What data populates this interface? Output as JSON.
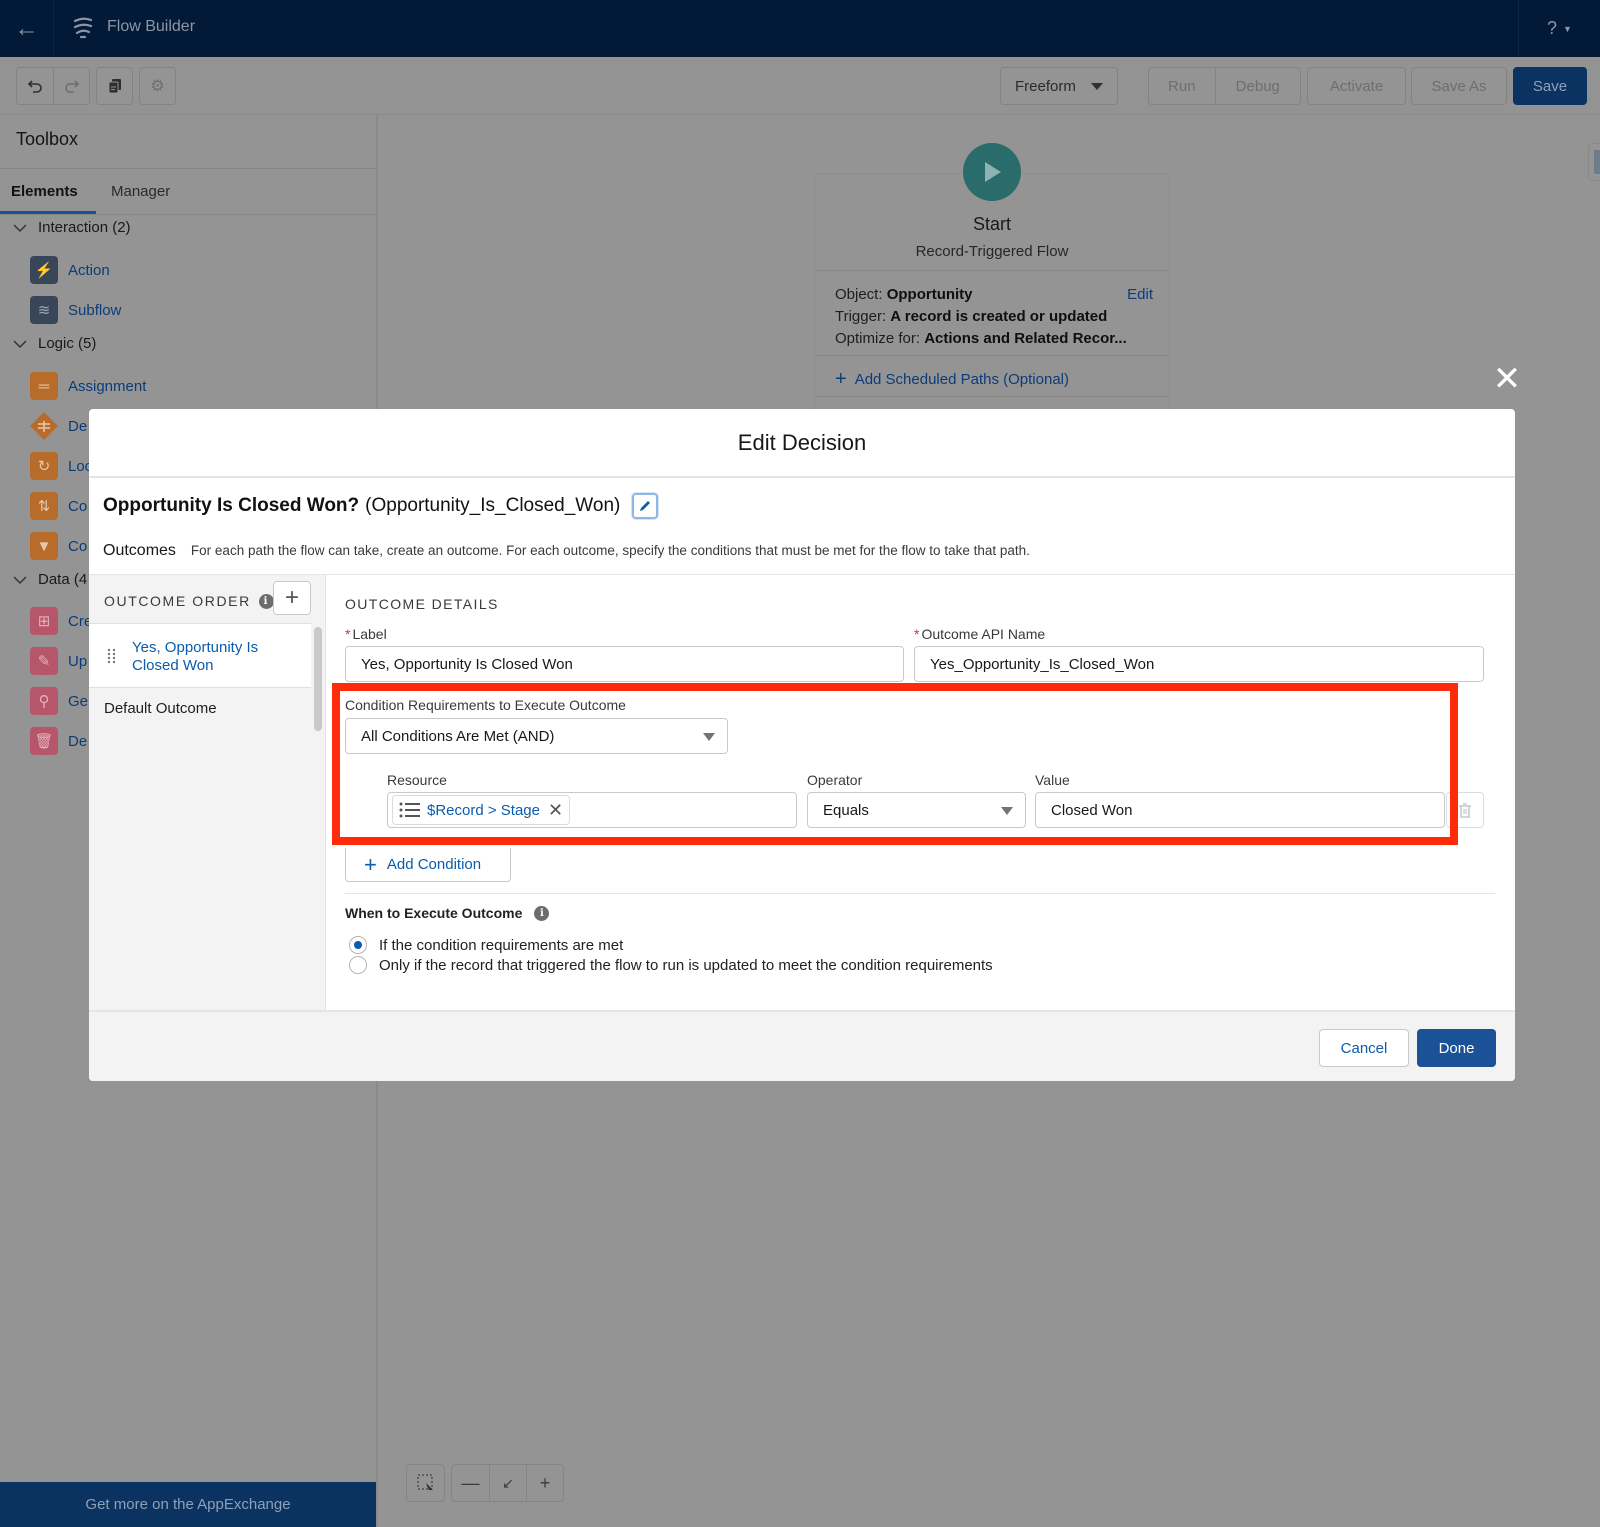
{
  "topbar": {
    "back_icon": "arrow-left-icon",
    "app_icon": "flow-icon",
    "app_title": "Flow Builder",
    "help_label": "?"
  },
  "toolbar": {
    "undo_icon": "undo-icon",
    "redo_icon": "redo-icon",
    "copy_icon": "copy-icon",
    "settings_icon": "gear-icon",
    "layout_select": "Freeform",
    "run_label": "Run",
    "debug_label": "Debug",
    "activate_label": "Activate",
    "save_as_label": "Save As",
    "save_label": "Save"
  },
  "toolbox": {
    "title": "Toolbox",
    "tabs": [
      {
        "label": "Elements",
        "active": true
      },
      {
        "label": "Manager",
        "active": false
      }
    ],
    "sections": [
      {
        "label": "Interaction (2)",
        "items": [
          {
            "label": "Action",
            "icon": "lightning-icon"
          },
          {
            "label": "Subflow",
            "icon": "flow-icon"
          }
        ]
      },
      {
        "label": "Logic (5)",
        "items": [
          {
            "label": "Assignment",
            "icon": "equals-icon"
          },
          {
            "label": "De",
            "icon": "decision-icon"
          },
          {
            "label": "Loo",
            "icon": "loop-icon"
          },
          {
            "label": "Co",
            "icon": "sort-icon"
          },
          {
            "label": "Co",
            "icon": "filter-icon"
          }
        ]
      },
      {
        "label": "Data (4",
        "items": [
          {
            "label": "Cre",
            "icon": "record-create-icon"
          },
          {
            "label": "Up",
            "icon": "record-update-icon"
          },
          {
            "label": "Ge",
            "icon": "record-lookup-icon"
          },
          {
            "label": "De",
            "icon": "record-delete-icon"
          }
        ]
      }
    ],
    "appexchange_label": "Get more on the AppExchange"
  },
  "canvas": {
    "start": {
      "title": "Start",
      "subtitle": "Record-Triggered Flow",
      "object_label": "Object:",
      "object_value": "Opportunity",
      "edit_label": "Edit",
      "trigger_label": "Trigger:",
      "trigger_value": "A record is created or updated",
      "optimize_label": "Optimize for:",
      "optimize_value": "Actions and Related Recor...",
      "add_paths_label": "Add Scheduled Paths (Optional)"
    }
  },
  "modal": {
    "title": "Edit Decision",
    "decision_label": "Opportunity Is Closed Won?",
    "decision_api_name": "(Opportunity_Is_Closed_Won)",
    "outcomes_label": "Outcomes",
    "outcomes_description": "For each path the flow can take, create an outcome. For each outcome, specify the conditions that must be met for the flow to take that path.",
    "outcome_order_label": "OUTCOME ORDER",
    "outcome_order_items": [
      {
        "label": "Yes, Opportunity Is Closed Won",
        "selected": true
      },
      {
        "label": "Default Outcome",
        "selected": false
      }
    ],
    "details": {
      "heading": "OUTCOME DETAILS",
      "label_field_label": "Label",
      "label_field_value": "Yes, Opportunity Is Closed Won",
      "api_name_field_label": "Outcome API Name",
      "api_name_field_value": "Yes_Opportunity_Is_Closed_Won",
      "condition_req_label": "Condition Requirements to Execute Outcome",
      "condition_req_value": "All Conditions Are Met (AND)",
      "condition": {
        "resource_label": "Resource",
        "resource_value": "$Record > Stage",
        "operator_label": "Operator",
        "operator_value": "Equals",
        "value_label": "Value",
        "value_value": "Closed Won"
      },
      "add_condition_label": "Add Condition",
      "when_label": "When to Execute Outcome",
      "when_options": [
        {
          "label": "If the condition requirements are met",
          "selected": true
        },
        {
          "label": "Only if the record that triggered the flow to run is updated to meet the condition requirements",
          "selected": false
        }
      ]
    },
    "cancel_label": "Cancel",
    "done_label": "Done"
  },
  "colors": {
    "brand_dark": "#021a38",
    "primary_button": "#1b5297",
    "link": "#0b5cab",
    "highlight": "#ff2a0a",
    "required": "#c23934"
  }
}
